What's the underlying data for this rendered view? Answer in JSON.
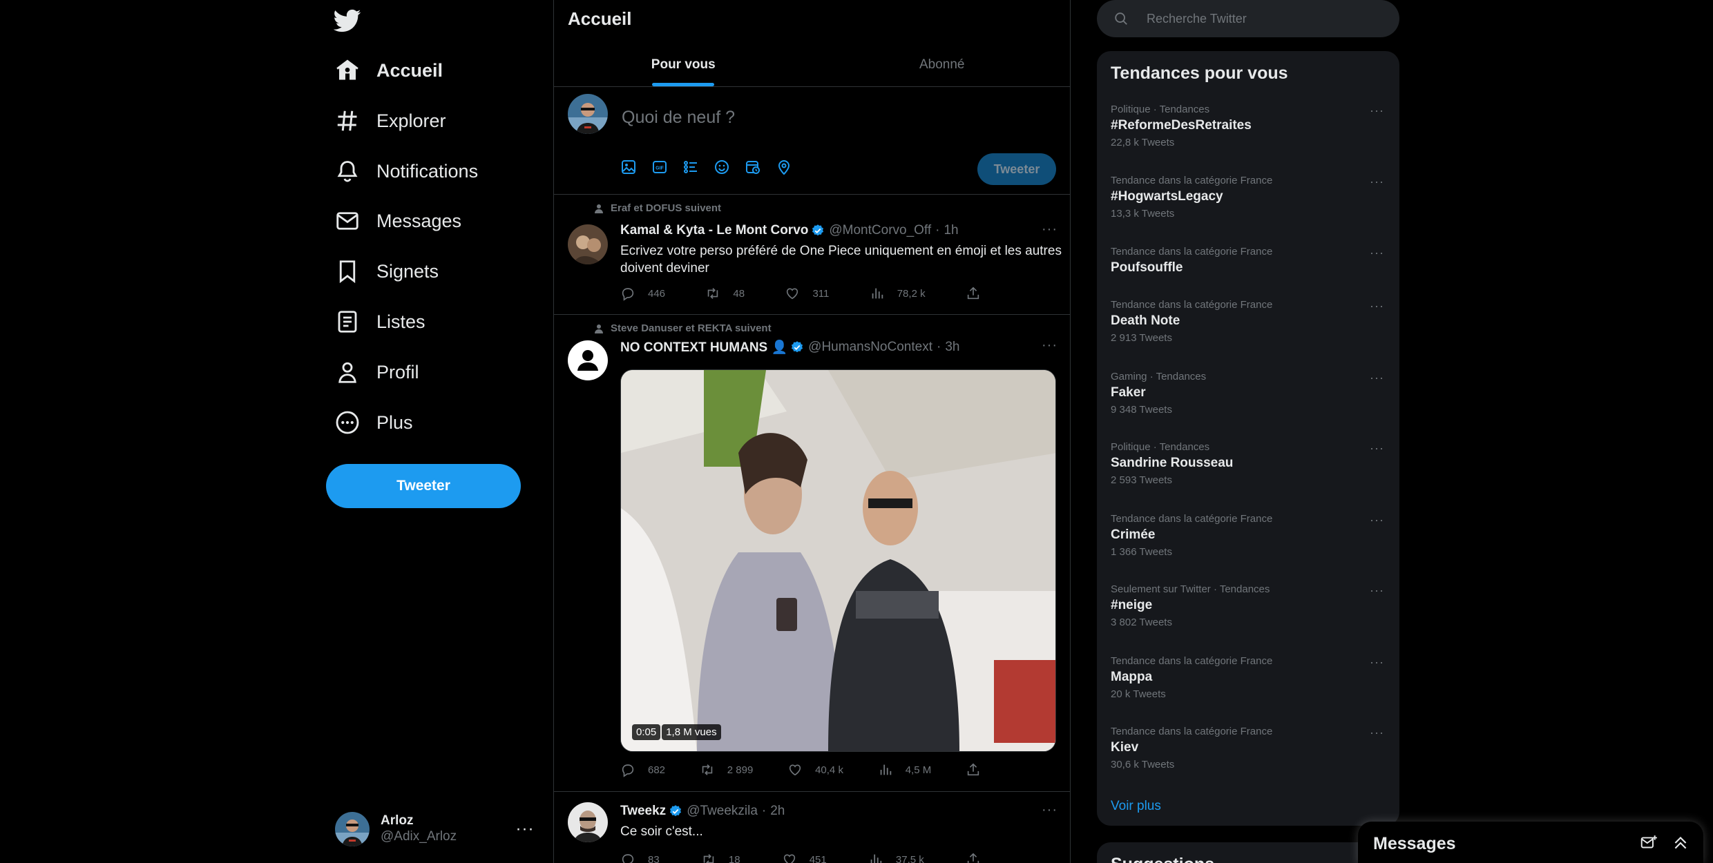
{
  "nav": {
    "items": [
      {
        "label": "Accueil",
        "icon": "home-icon",
        "active": true
      },
      {
        "label": "Explorer",
        "icon": "hashtag-icon",
        "active": false
      },
      {
        "label": "Notifications",
        "icon": "bell-icon",
        "active": false
      },
      {
        "label": "Messages",
        "icon": "envelope-icon",
        "active": false
      },
      {
        "label": "Signets",
        "icon": "bookmark-icon",
        "active": false
      },
      {
        "label": "Listes",
        "icon": "list-icon",
        "active": false
      },
      {
        "label": "Profil",
        "icon": "person-icon",
        "active": false
      },
      {
        "label": "Plus",
        "icon": "more-circle-icon",
        "active": false
      }
    ],
    "tweet_button": "Tweeter"
  },
  "account": {
    "display_name": "Arloz",
    "handle": "@Adix_Arloz",
    "more": "···"
  },
  "main": {
    "title": "Accueil",
    "tabs": [
      {
        "label": "Pour vous",
        "active": true
      },
      {
        "label": "Abonné",
        "active": false
      }
    ],
    "composer": {
      "placeholder": "Quoi de neuf ?",
      "send_label": "Tweeter"
    }
  },
  "tweets": [
    {
      "social": "Eraf et DOFUS suivent",
      "name": "Kamal & Kyta - Le Mont Corvo",
      "handle": "@MontCorvo_Off",
      "dot": "·",
      "time": "1h",
      "text": "Ecrivez votre perso préféré de One Piece uniquement en émoji et les autres doivent deviner",
      "replies": "446",
      "retweets": "48",
      "likes": "311",
      "views": "78,2 k"
    },
    {
      "social": "Steve Danuser et REKTA suivent",
      "name": "NO CONTEXT HUMANS 👤",
      "handle": "@HumansNoContext",
      "dot": "·",
      "time": "3h",
      "video": {
        "duration": "0:05",
        "views": "1,8 M vues"
      },
      "replies": "682",
      "retweets": "2 899",
      "likes": "40,4 k",
      "views": "4,5 M"
    },
    {
      "name": "Tweekz",
      "handle": "@Tweekzila",
      "dot": "·",
      "time": "2h",
      "text": "Ce soir c'est...",
      "replies": "83",
      "retweets": "18",
      "likes": "451",
      "views": "37,5 k"
    }
  ],
  "search": {
    "placeholder": "Recherche Twitter"
  },
  "trends": {
    "title": "Tendances pour vous",
    "items": [
      {
        "context": "Politique · Tendances",
        "name": "#ReformeDesRetraites",
        "count": "22,8 k Tweets"
      },
      {
        "context": "Tendance dans la catégorie France",
        "name": "#HogwartsLegacy",
        "count": "13,3 k Tweets"
      },
      {
        "context": "Tendance dans la catégorie France",
        "name": "Poufsouffle",
        "count": ""
      },
      {
        "context": "Tendance dans la catégorie France",
        "name": "Death Note",
        "count": "2 913 Tweets"
      },
      {
        "context": "Gaming · Tendances",
        "name": "Faker",
        "count": "9 348 Tweets"
      },
      {
        "context": "Politique · Tendances",
        "name": "Sandrine Rousseau",
        "count": "2 593 Tweets"
      },
      {
        "context": "Tendance dans la catégorie France",
        "name": "Crimée",
        "count": "1 366 Tweets"
      },
      {
        "context": "Seulement sur Twitter · Tendances",
        "name": "#neige",
        "count": "3 802 Tweets"
      },
      {
        "context": "Tendance dans la catégorie France",
        "name": "Mappa",
        "count": "20 k Tweets"
      },
      {
        "context": "Tendance dans la catégorie France",
        "name": "Kiev",
        "count": "30,6 k Tweets"
      }
    ],
    "more_dots": "···",
    "show_more": "Voir plus"
  },
  "next_card": {
    "title": "Suggestions"
  },
  "messages_drawer": {
    "title": "Messages"
  },
  "colors": {
    "accent": "#1d9bf0",
    "background": "#000000",
    "card": "#16181c",
    "muted": "#71767b",
    "text": "#e7e9ea"
  }
}
